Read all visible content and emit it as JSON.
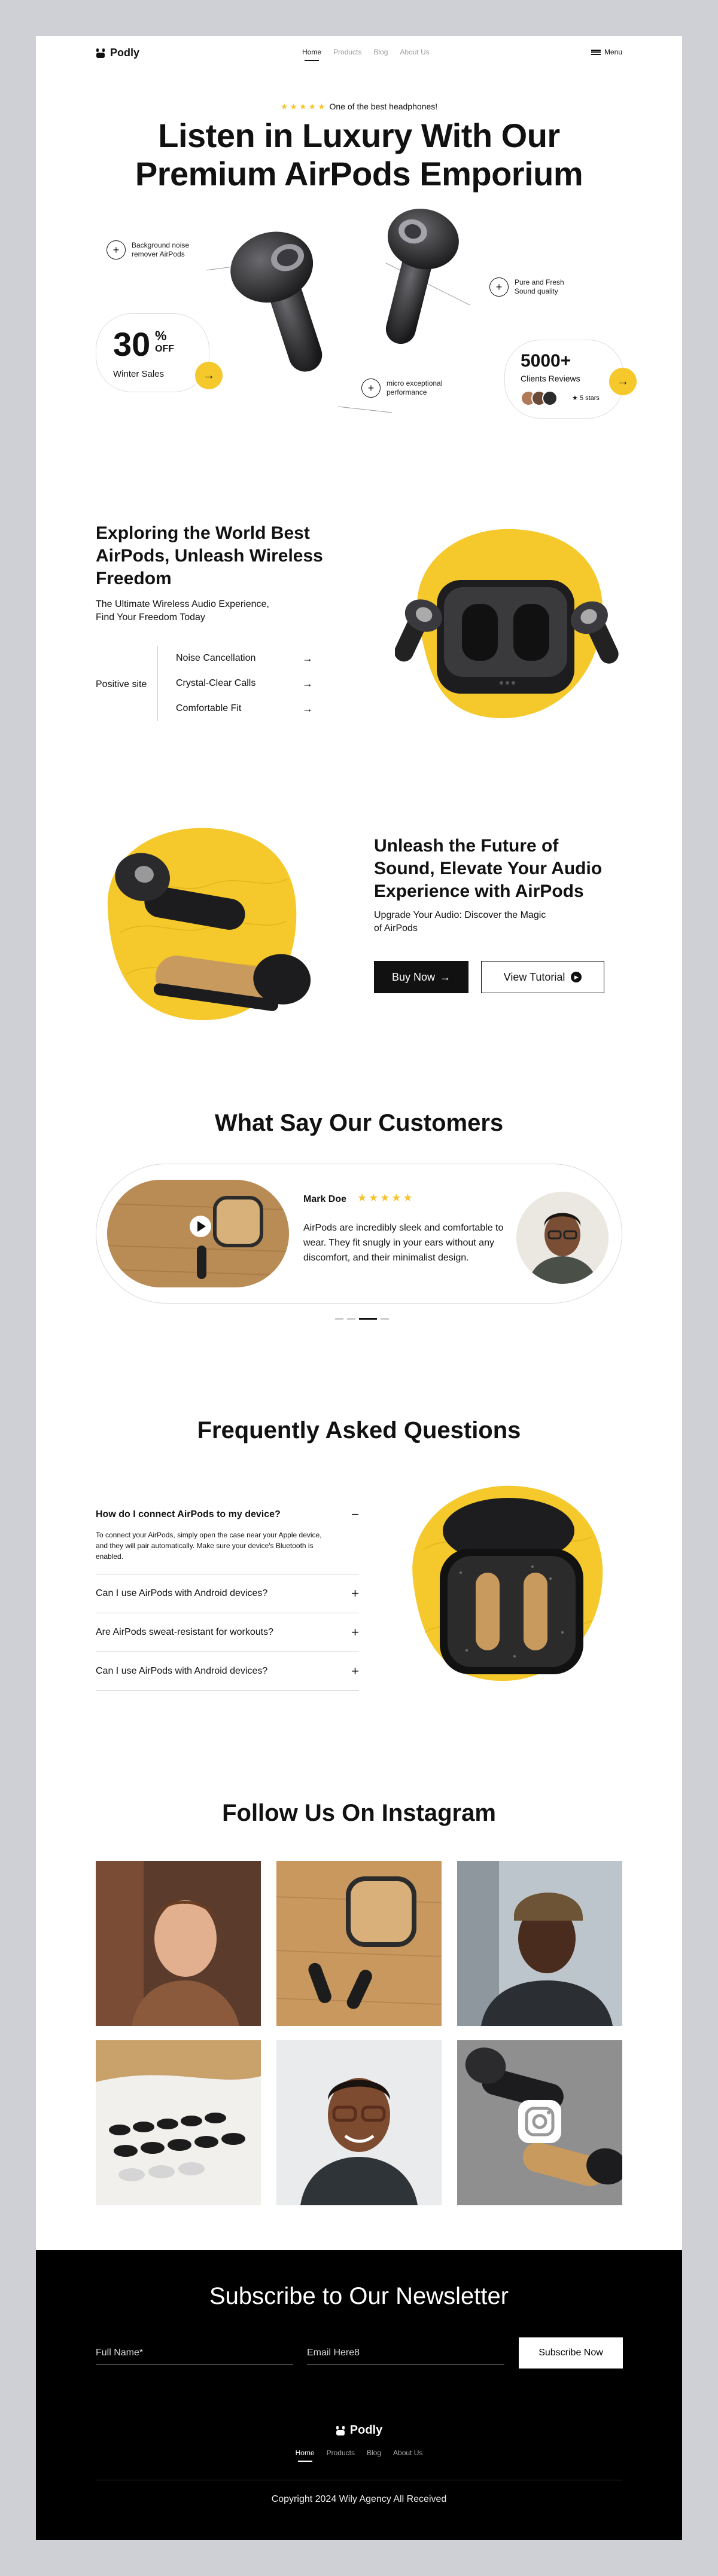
{
  "nav": {
    "brand": "Podly",
    "links": [
      "Home",
      "Products",
      "Blog",
      "About Us"
    ],
    "menu_label": "Menu"
  },
  "hero": {
    "stars": "★★★★★",
    "rating_text": "One of the best headphones!",
    "title_line1": "Listen in Luxury With Our",
    "title_line2": "Premium AirPods Emporium",
    "features": {
      "noise": [
        "Background noise",
        "remover AirPods"
      ],
      "sound": [
        "Pure and Fresh",
        "Sound quality"
      ],
      "mic": [
        "micro exceptional",
        "performance"
      ]
    },
    "sale": {
      "number": "30",
      "percent": "%",
      "off": "OFF",
      "label": "Winter Sales"
    },
    "reviews": {
      "number": "5000+",
      "label": "Clients Reviews",
      "stars": "★ 5 stars"
    }
  },
  "explore": {
    "title_lines": [
      "Exploring the World Best",
      "AirPods, Unleash Wireless",
      "Freedom"
    ],
    "subtitle_lines": [
      "The Ultimate Wireless Audio Experience,",
      "Find Your Freedom Today"
    ],
    "side_label": "Positive site",
    "features": [
      "Noise Cancellation",
      "Crystal-Clear Calls",
      "Comfortable Fit"
    ]
  },
  "future": {
    "title_lines": [
      "Unleash the Future of",
      "Sound, Elevate Your Audio",
      "Experience with AirPods"
    ],
    "subtitle_lines": [
      "Upgrade Your Audio: Discover the Magic",
      "of AirPods"
    ],
    "buy_label": "Buy Now",
    "tutorial_label": "View Tutorial"
  },
  "customers": {
    "title": "What Say Our Customers",
    "name": "Mark Doe",
    "stars": "★★★★★",
    "quote": "AirPods are incredibly sleek and comfortable to wear. They fit snugly in your ears without any discomfort, and their minimalist design."
  },
  "faq": {
    "title": "Frequently Asked Questions",
    "items": [
      {
        "q": "How do I connect AirPods to my device?",
        "a": "To connect your AirPods, simply open the case near your Apple device, and they will pair automatically. Make sure your device's Bluetooth is enabled.",
        "open": true
      },
      {
        "q": "Can I use AirPods with Android devices?",
        "open": false
      },
      {
        "q": "Are AirPods sweat-resistant for workouts?",
        "open": false
      },
      {
        "q": "Can I use AirPods with Android devices?",
        "open": false
      }
    ]
  },
  "instagram": {
    "title": "Follow Us On Instagram"
  },
  "footer": {
    "title": "Subscribe to Our Newsletter",
    "name_placeholder": "Full Name*",
    "email_placeholder": "Email Here8",
    "subscribe_label": "Subscribe Now",
    "brand": "Podly",
    "links": [
      "Home",
      "Products",
      "Blog",
      "About Us"
    ],
    "copyright": "Copyright 2024 Wily Agency All Received"
  },
  "colors": {
    "accent": "#f5c82b",
    "dark": "#111111",
    "bg": "#cfd0d6"
  }
}
